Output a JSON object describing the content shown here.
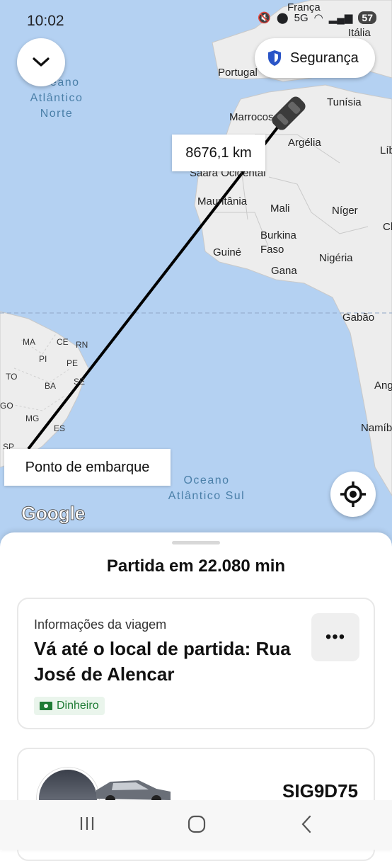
{
  "status_bar": {
    "time": "10:02",
    "network": "5G",
    "battery": "57"
  },
  "map": {
    "countries": [
      {
        "name": "França"
      },
      {
        "name": "Itália"
      },
      {
        "name": "Portugal"
      },
      {
        "name": "Marrocos"
      },
      {
        "name": "Tunísia"
      },
      {
        "name": "Argélia"
      },
      {
        "name": "Líbia"
      },
      {
        "name": "Saara Ocidental"
      },
      {
        "name": "Mauritânia"
      },
      {
        "name": "Mali"
      },
      {
        "name": "Níger"
      },
      {
        "name": "Burkina Faso"
      },
      {
        "name": "Guiné"
      },
      {
        "name": "Nigéria"
      },
      {
        "name": "Gana"
      },
      {
        "name": "Gabão"
      },
      {
        "name": "Angola"
      },
      {
        "name": "Namíbia"
      },
      {
        "name": "Chade"
      }
    ],
    "states": [
      "MA",
      "CE",
      "RN",
      "PI",
      "PE",
      "TO",
      "BA",
      "SE",
      "GO",
      "MG",
      "ES",
      "SP"
    ],
    "ocean_north": "Oceano Atlântico Norte",
    "ocean_south": "Oceano Atlântico Sul",
    "distance": "8676,1 km",
    "pickup_label": "Ponto de embarque",
    "attribution": "Google",
    "route_color": "#000000"
  },
  "buttons": {
    "safety_label": "Segurança",
    "collapse_icon": "chevron-down-icon",
    "locate_icon": "crosshair-icon"
  },
  "sheet": {
    "title": "Partida em 22.080 min",
    "trip_card": {
      "label": "Informações da viagem",
      "destination": "Vá até o local de partida: Rua José de Alencar",
      "payment": "Dinheiro",
      "more": "•••"
    },
    "driver_card": {
      "plate": "SIG9D75"
    }
  },
  "colors": {
    "shield": "#2a55c7",
    "payment_green": "#1e7b34"
  }
}
